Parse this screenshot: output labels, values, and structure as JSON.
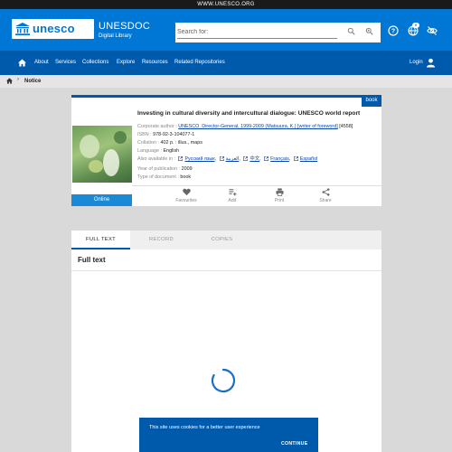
{
  "topbar": {
    "url": "WWW.UNESCO.ORG"
  },
  "header": {
    "logo_text": "unesco",
    "brand_title": "UNESDOC",
    "brand_subtitle": "Digital Library",
    "search_placeholder": "Search for:",
    "notification_count": "0"
  },
  "nav": {
    "items": [
      "About",
      "Services",
      "Collections",
      "Explore",
      "Resources",
      "Related Repositories"
    ],
    "login": "Login"
  },
  "breadcrumb": {
    "current": "Notice"
  },
  "record": {
    "badge": "book",
    "title": "Investing in cultural diversity and intercultural dialogue: UNESCO world report",
    "corporate_author_label": "Corporate author :",
    "corporate_author": "UNESCO. Director-General, 1999-2009 (Matsuura, K.) [writer of foreword]",
    "corporate_author_id": "[4558]",
    "isbn_label": "ISBN :",
    "isbn": "978-92-3-104077-1",
    "collation_label": "Collation :",
    "collation": "402 p. : illus., maps",
    "language_label": "Language :",
    "language": "English",
    "also_available_label": "Also available in :",
    "also_available": [
      "Русский язык",
      "العربية",
      "中文",
      "Français",
      "Español"
    ],
    "year_label": "Year of publication :",
    "year": "2009",
    "type_label": "Type of document :",
    "type": "book",
    "online_button": "Online",
    "actions": [
      "Favourites",
      "Add",
      "Print",
      "Share"
    ]
  },
  "tabs": [
    "FULL TEXT",
    "RECORD",
    "COPIES"
  ],
  "fulltext": {
    "title": "Full text"
  },
  "cookie": {
    "message": "This site uses cookies for a better user experience",
    "button": "CONTINUE"
  },
  "colors": {
    "brand_blue": "#0077d4",
    "nav_blue": "#005aab",
    "link": "#0645ad"
  }
}
